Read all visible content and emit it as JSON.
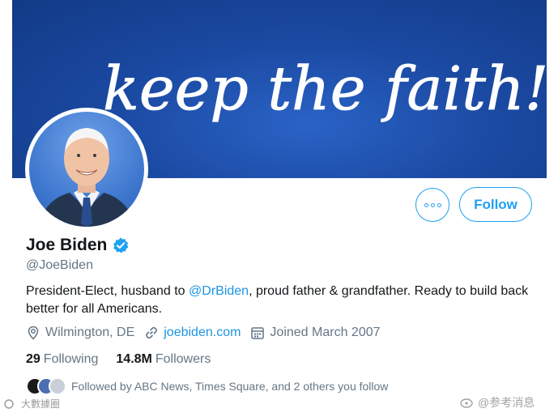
{
  "banner": {
    "text": "keep the faith!",
    "colors": {
      "dark": "#123a86",
      "light": "#2a63c6"
    }
  },
  "profile": {
    "name": "Joe Biden",
    "handle": "@JoeBiden",
    "bio_parts": [
      "President-Elect, husband to ",
      "@DrBiden",
      ", proud father & grandfather. Ready to build back better for all Americans."
    ],
    "location": "Wilmington, DE",
    "website": "joebiden.com",
    "joined": "Joined March 2007"
  },
  "stats": {
    "following_count": "29",
    "following_label": "Following",
    "followers_count": "14.8M",
    "followers_label": "Followers"
  },
  "followed_by": "Followed by ABC News, Times Square, and 2 others you follow",
  "actions": {
    "follow_label": "Follow"
  },
  "watermarks": {
    "left": "大數據圈",
    "right": "@参考消息"
  },
  "colors": {
    "accent": "#1da1f2",
    "link": "#1b95e0",
    "muted": "#657786",
    "text": "#14171a"
  },
  "icons": [
    "more-icon",
    "verified-badge-icon",
    "location-icon",
    "link-icon",
    "calendar-icon"
  ]
}
